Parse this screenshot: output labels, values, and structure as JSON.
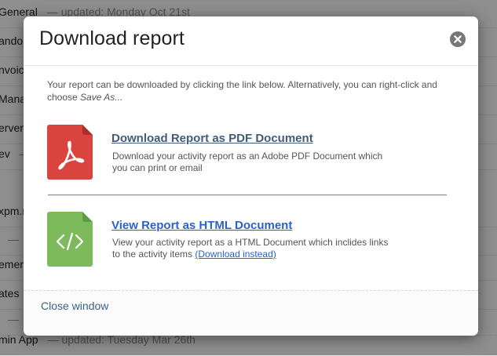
{
  "background": {
    "rows": [
      {
        "name": "General",
        "updated": "— updated: Monday Oct 21st"
      },
      {
        "name": "andom",
        "updated": ""
      },
      {
        "name": "nvoici",
        "updated": ""
      },
      {
        "name": "Manag",
        "updated": ""
      },
      {
        "name": "erver",
        "updated": ""
      },
      {
        "name": "ev",
        "updated": "—"
      },
      {
        "name": "xpm.n",
        "updated": ""
      },
      {
        "name": "",
        "updated": "—"
      },
      {
        "name": "emen",
        "updated": ""
      },
      {
        "name": "ates",
        "updated": ""
      },
      {
        "name": "",
        "updated": "—"
      },
      {
        "name": "min App",
        "updated": "— updated: Tuesday Mar 26th"
      }
    ]
  },
  "modal": {
    "title": "Download report",
    "close_icon": "close-circle-icon",
    "intro_text": "Your report can be downloaded by clicking the link below. Alternatively, you can right-click and choose ",
    "intro_emphasis": "Save As...",
    "pdf": {
      "icon": "pdf-file-icon",
      "icon_color": "#d9443f",
      "title": "Download Report as PDF Document",
      "description": "Download your activity report as an Adobe PDF Document which you can print or email"
    },
    "html": {
      "icon": "html-file-icon",
      "icon_color": "#7cba5c",
      "icon_glyph": "</>",
      "title": "View Report as HTML Document",
      "description": "View your activity report as a HTML Document which inclides links to the activity items",
      "download_link": "(Download instead)"
    },
    "footer": {
      "close_label": "Close window"
    }
  }
}
